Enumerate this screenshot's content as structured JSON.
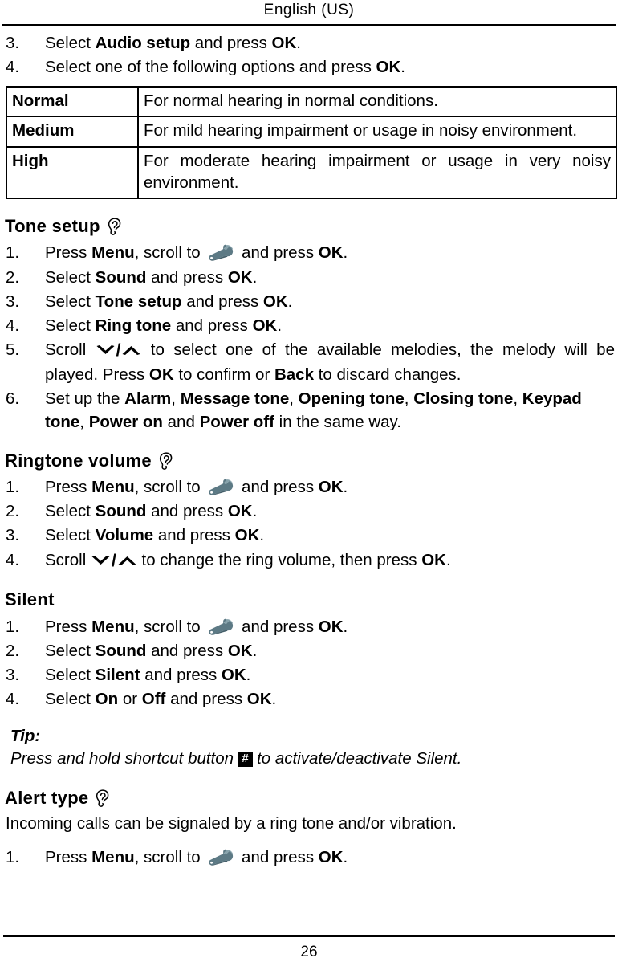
{
  "header": {
    "running_title": "English (US)"
  },
  "footer": {
    "page_number": "26"
  },
  "icons": {
    "ear": "ear-icon",
    "wrench": "wrench-icon",
    "chevron_down": "chevron-down-icon",
    "chevron_up": "chevron-up-icon",
    "hash_key": "#"
  },
  "colors": {
    "text": "#000000",
    "background": "#ffffff",
    "wrench_body": "#5d7a85",
    "wrench_shade": "#46606b",
    "wrench_light": "#86a2ab",
    "rule": "#000000"
  },
  "intro_steps": [
    {
      "num": "3.",
      "parts": [
        {
          "t": "Select ",
          "b": false
        },
        {
          "t": "Audio setup",
          "b": true
        },
        {
          "t": " and press ",
          "b": false
        },
        {
          "t": "OK",
          "b": true
        },
        {
          "t": ".",
          "b": false
        }
      ]
    },
    {
      "num": "4.",
      "parts": [
        {
          "t": "Select one of the following options and press ",
          "b": false
        },
        {
          "t": "OK",
          "b": true
        },
        {
          "t": ".",
          "b": false
        }
      ]
    }
  ],
  "options_table": {
    "rows": [
      {
        "label": "Normal",
        "description": "For normal hearing in normal conditions."
      },
      {
        "label": "Medium",
        "description": "For mild hearing impairment or usage in noisy environment."
      },
      {
        "label": "High",
        "description": "For moderate hearing impairment or usage in very noisy environment."
      }
    ]
  },
  "sections": [
    {
      "id": "tone-setup",
      "title": "Tone setup",
      "has_ear_icon": true,
      "steps": [
        {
          "num": "1.",
          "parts": [
            {
              "t": "Press ",
              "b": false
            },
            {
              "t": "Menu",
              "b": true
            },
            {
              "t": ", scroll to ",
              "b": false
            },
            {
              "t": "[wrench]",
              "b": false,
              "icon": "wrench"
            },
            {
              "t": " and press ",
              "b": false
            },
            {
              "t": "OK",
              "b": true
            },
            {
              "t": ".",
              "b": false
            }
          ]
        },
        {
          "num": "2.",
          "parts": [
            {
              "t": "Select ",
              "b": false
            },
            {
              "t": "Sound",
              "b": true
            },
            {
              "t": " and press ",
              "b": false
            },
            {
              "t": "OK",
              "b": true
            },
            {
              "t": ".",
              "b": false
            }
          ]
        },
        {
          "num": "3.",
          "parts": [
            {
              "t": "Select ",
              "b": false
            },
            {
              "t": "Tone setup",
              "b": true
            },
            {
              "t": " and press ",
              "b": false
            },
            {
              "t": "OK",
              "b": true
            },
            {
              "t": ".",
              "b": false
            }
          ]
        },
        {
          "num": "4.",
          "parts": [
            {
              "t": "Select ",
              "b": false
            },
            {
              "t": "Ring tone",
              "b": true
            },
            {
              "t": " and press ",
              "b": false
            },
            {
              "t": "OK",
              "b": true
            },
            {
              "t": ".",
              "b": false
            }
          ]
        },
        {
          "num": "5.",
          "justify": true,
          "parts": [
            {
              "t": "Scroll ",
              "b": false
            },
            {
              "t": "[scroll]",
              "b": false,
              "icon": "scroll"
            },
            {
              "t": " to select one of the available melodies, the melody will be played. Press ",
              "b": false
            },
            {
              "t": "OK",
              "b": true
            },
            {
              "t": " to confirm or ",
              "b": false
            },
            {
              "t": "Back",
              "b": true
            },
            {
              "t": " to discard changes.",
              "b": false
            }
          ]
        },
        {
          "num": "6.",
          "parts": [
            {
              "t": "Set up the ",
              "b": false
            },
            {
              "t": "Alarm",
              "b": true
            },
            {
              "t": ", ",
              "b": false
            },
            {
              "t": "Message tone",
              "b": true
            },
            {
              "t": ", ",
              "b": false
            },
            {
              "t": "Opening tone",
              "b": true
            },
            {
              "t": ", ",
              "b": false
            },
            {
              "t": "Closing tone",
              "b": true
            },
            {
              "t": ", ",
              "b": false
            },
            {
              "t": "Keypad tone",
              "b": true
            },
            {
              "t": ", ",
              "b": false
            },
            {
              "t": "Power on",
              "b": true
            },
            {
              "t": " and ",
              "b": false
            },
            {
              "t": "Power off",
              "b": true
            },
            {
              "t": " in the same way.",
              "b": false
            }
          ]
        }
      ]
    },
    {
      "id": "ringtone-volume",
      "title": "Ringtone volume",
      "has_ear_icon": true,
      "steps": [
        {
          "num": "1.",
          "parts": [
            {
              "t": "Press ",
              "b": false
            },
            {
              "t": "Menu",
              "b": true
            },
            {
              "t": ", scroll to ",
              "b": false
            },
            {
              "t": "[wrench]",
              "b": false,
              "icon": "wrench"
            },
            {
              "t": " and press ",
              "b": false
            },
            {
              "t": "OK",
              "b": true
            },
            {
              "t": ".",
              "b": false
            }
          ]
        },
        {
          "num": "2.",
          "parts": [
            {
              "t": "Select ",
              "b": false
            },
            {
              "t": "Sound",
              "b": true
            },
            {
              "t": " and press ",
              "b": false
            },
            {
              "t": "OK",
              "b": true
            },
            {
              "t": ".",
              "b": false
            }
          ]
        },
        {
          "num": "3.",
          "parts": [
            {
              "t": "Select ",
              "b": false
            },
            {
              "t": "Volume",
              "b": true
            },
            {
              "t": " and press ",
              "b": false
            },
            {
              "t": "OK",
              "b": true
            },
            {
              "t": ".",
              "b": false
            }
          ]
        },
        {
          "num": "4.",
          "parts": [
            {
              "t": "Scroll ",
              "b": false
            },
            {
              "t": "[scroll]",
              "b": false,
              "icon": "scroll"
            },
            {
              "t": " to change the ring volume, then press ",
              "b": false
            },
            {
              "t": "OK",
              "b": true
            },
            {
              "t": ".",
              "b": false
            }
          ]
        }
      ]
    },
    {
      "id": "silent",
      "title": "Silent",
      "has_ear_icon": false,
      "steps": [
        {
          "num": "1.",
          "parts": [
            {
              "t": "Press ",
              "b": false
            },
            {
              "t": "Menu",
              "b": true
            },
            {
              "t": ", scroll to ",
              "b": false
            },
            {
              "t": "[wrench]",
              "b": false,
              "icon": "wrench"
            },
            {
              "t": " and press ",
              "b": false
            },
            {
              "t": "OK",
              "b": true
            },
            {
              "t": ".",
              "b": false
            }
          ]
        },
        {
          "num": "2.",
          "parts": [
            {
              "t": "Select ",
              "b": false
            },
            {
              "t": "Sound",
              "b": true
            },
            {
              "t": " and press ",
              "b": false
            },
            {
              "t": "OK",
              "b": true
            },
            {
              "t": ".",
              "b": false
            }
          ]
        },
        {
          "num": "3.",
          "parts": [
            {
              "t": "Select ",
              "b": false
            },
            {
              "t": "Silent",
              "b": true
            },
            {
              "t": " and press ",
              "b": false
            },
            {
              "t": "OK",
              "b": true
            },
            {
              "t": ".",
              "b": false
            }
          ]
        },
        {
          "num": "4.",
          "parts": [
            {
              "t": "Select ",
              "b": false
            },
            {
              "t": "On",
              "b": true
            },
            {
              "t": " or ",
              "b": false
            },
            {
              "t": "Off",
              "b": true
            },
            {
              "t": " and press ",
              "b": false
            },
            {
              "t": "OK",
              "b": true
            },
            {
              "t": ".",
              "b": false
            }
          ]
        }
      ]
    }
  ],
  "tip": {
    "title": "Tip:",
    "text_before": "Press and hold shortcut button",
    "key_label": "#",
    "text_after": "to activate/deactivate Silent."
  },
  "alert_type": {
    "title": "Alert type",
    "has_ear_icon": true,
    "paragraph": "Incoming calls can be signaled by a ring tone and/or vibration.",
    "steps": [
      {
        "num": "1.",
        "parts": [
          {
            "t": "Press ",
            "b": false
          },
          {
            "t": "Menu",
            "b": true
          },
          {
            "t": ", scroll to ",
            "b": false
          },
          {
            "t": "[wrench]",
            "b": false,
            "icon": "wrench"
          },
          {
            "t": " and press ",
            "b": false
          },
          {
            "t": "OK",
            "b": true
          },
          {
            "t": ".",
            "b": false
          }
        ]
      }
    ]
  }
}
